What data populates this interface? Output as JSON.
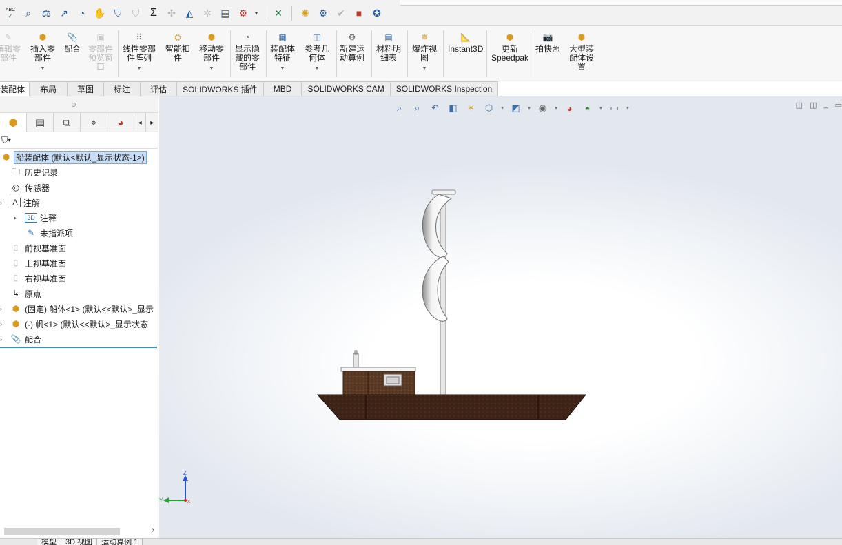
{
  "quickbar": {
    "icons": [
      "spellcheck-icon",
      "magnify-icon",
      "scale-icon",
      "export-icon",
      "gauge-icon",
      "hand-icon",
      "shield-icon",
      "shield-check-icon",
      "sigma-icon",
      "move-icon",
      "mirror-icon",
      "explode-icon",
      "doc-icon",
      "interference-icon",
      "dropdown-icon",
      "excel-icon",
      "wrench-icon",
      "gear-icon",
      "check-icon",
      "square-icon",
      "settings-icon"
    ],
    "abc_label": "ABC"
  },
  "commands": [
    {
      "id": "edit-component",
      "label": "编辑零\n部件",
      "enabled": false,
      "has_arrow": false
    },
    {
      "id": "insert-component",
      "label": "插入零\n部件",
      "enabled": true,
      "has_arrow": true
    },
    {
      "id": "mate",
      "label": "配合",
      "enabled": true,
      "has_arrow": false
    },
    {
      "id": "component-preview",
      "label": "零部件\n预览窗\n口",
      "enabled": false,
      "has_arrow": false
    },
    {
      "id": "linear-pattern",
      "label": "线性零部\n件阵列",
      "enabled": true,
      "has_arrow": true
    },
    {
      "id": "smart-fasteners",
      "label": "智能扣\n件",
      "enabled": true,
      "has_arrow": false
    },
    {
      "id": "move-component",
      "label": "移动零\n部件",
      "enabled": true,
      "has_arrow": true
    },
    {
      "id": "show-hidden",
      "label": "显示隐\n藏的零\n部件",
      "enabled": true,
      "has_arrow": false
    },
    {
      "id": "assembly-features",
      "label": "装配体\n特征",
      "enabled": true,
      "has_arrow": true
    },
    {
      "id": "reference-geometry",
      "label": "参考几\n何体",
      "enabled": true,
      "has_arrow": true
    },
    {
      "id": "new-motion-study",
      "label": "新建运\n动算例",
      "enabled": true,
      "has_arrow": false
    },
    {
      "id": "bill-of-materials",
      "label": "材料明\n细表",
      "enabled": true,
      "has_arrow": false
    },
    {
      "id": "exploded-view",
      "label": "爆炸视\n图",
      "enabled": true,
      "has_arrow": true
    },
    {
      "id": "instant3d",
      "label": "Instant3D",
      "enabled": true,
      "has_arrow": false
    },
    {
      "id": "update-speedpak",
      "label": "更新\nSpeedpak",
      "enabled": true,
      "has_arrow": false
    },
    {
      "id": "snapshot",
      "label": "拍快照",
      "enabled": true,
      "has_arrow": false
    },
    {
      "id": "large-assembly",
      "label": "大型装\n配体设\n置",
      "enabled": true,
      "has_arrow": false
    }
  ],
  "tabs": [
    "装配体",
    "布局",
    "草图",
    "标注",
    "评估",
    "SOLIDWORKS 插件",
    "MBD",
    "SOLIDWORKS CAM",
    "SOLIDWORKS Inspection"
  ],
  "active_tab": "装配体",
  "feature_tree": {
    "root": "船装配体  (默认<默认_显示状态-1>)",
    "items": [
      {
        "label": "历史记录",
        "icon": "history-icon"
      },
      {
        "label": "传感器",
        "icon": "sensor-icon"
      },
      {
        "label": "注解",
        "icon": "annotation-icon"
      },
      {
        "label": "注释",
        "icon": "note-3d-icon"
      },
      {
        "label": "未指派项",
        "icon": "unassigned-icon"
      },
      {
        "label": "前视基准面",
        "icon": "plane-icon"
      },
      {
        "label": "上视基准面",
        "icon": "plane-icon"
      },
      {
        "label": "右视基准面",
        "icon": "plane-icon"
      },
      {
        "label": "原点",
        "icon": "origin-icon"
      },
      {
        "label": "(固定) 船体<1> (默认<<默认>_显示",
        "icon": "part-icon"
      },
      {
        "label": "(-) 帆<1> (默认<<默认>_显示状态",
        "icon": "part-icon"
      },
      {
        "label": "配合",
        "icon": "mates-icon"
      }
    ]
  },
  "bottom_tabs": [
    "模型",
    "3D 视图",
    "运动算例 1"
  ],
  "triad": {
    "z": "Z",
    "y": "Y",
    "x": "X"
  },
  "colors": {
    "hull": "#3d2416",
    "cabin": "#5a3a24",
    "sail": "#ffffff",
    "mast": "#e8e8e8",
    "selection": "#c9def5",
    "accent": "#3b8fd6"
  }
}
